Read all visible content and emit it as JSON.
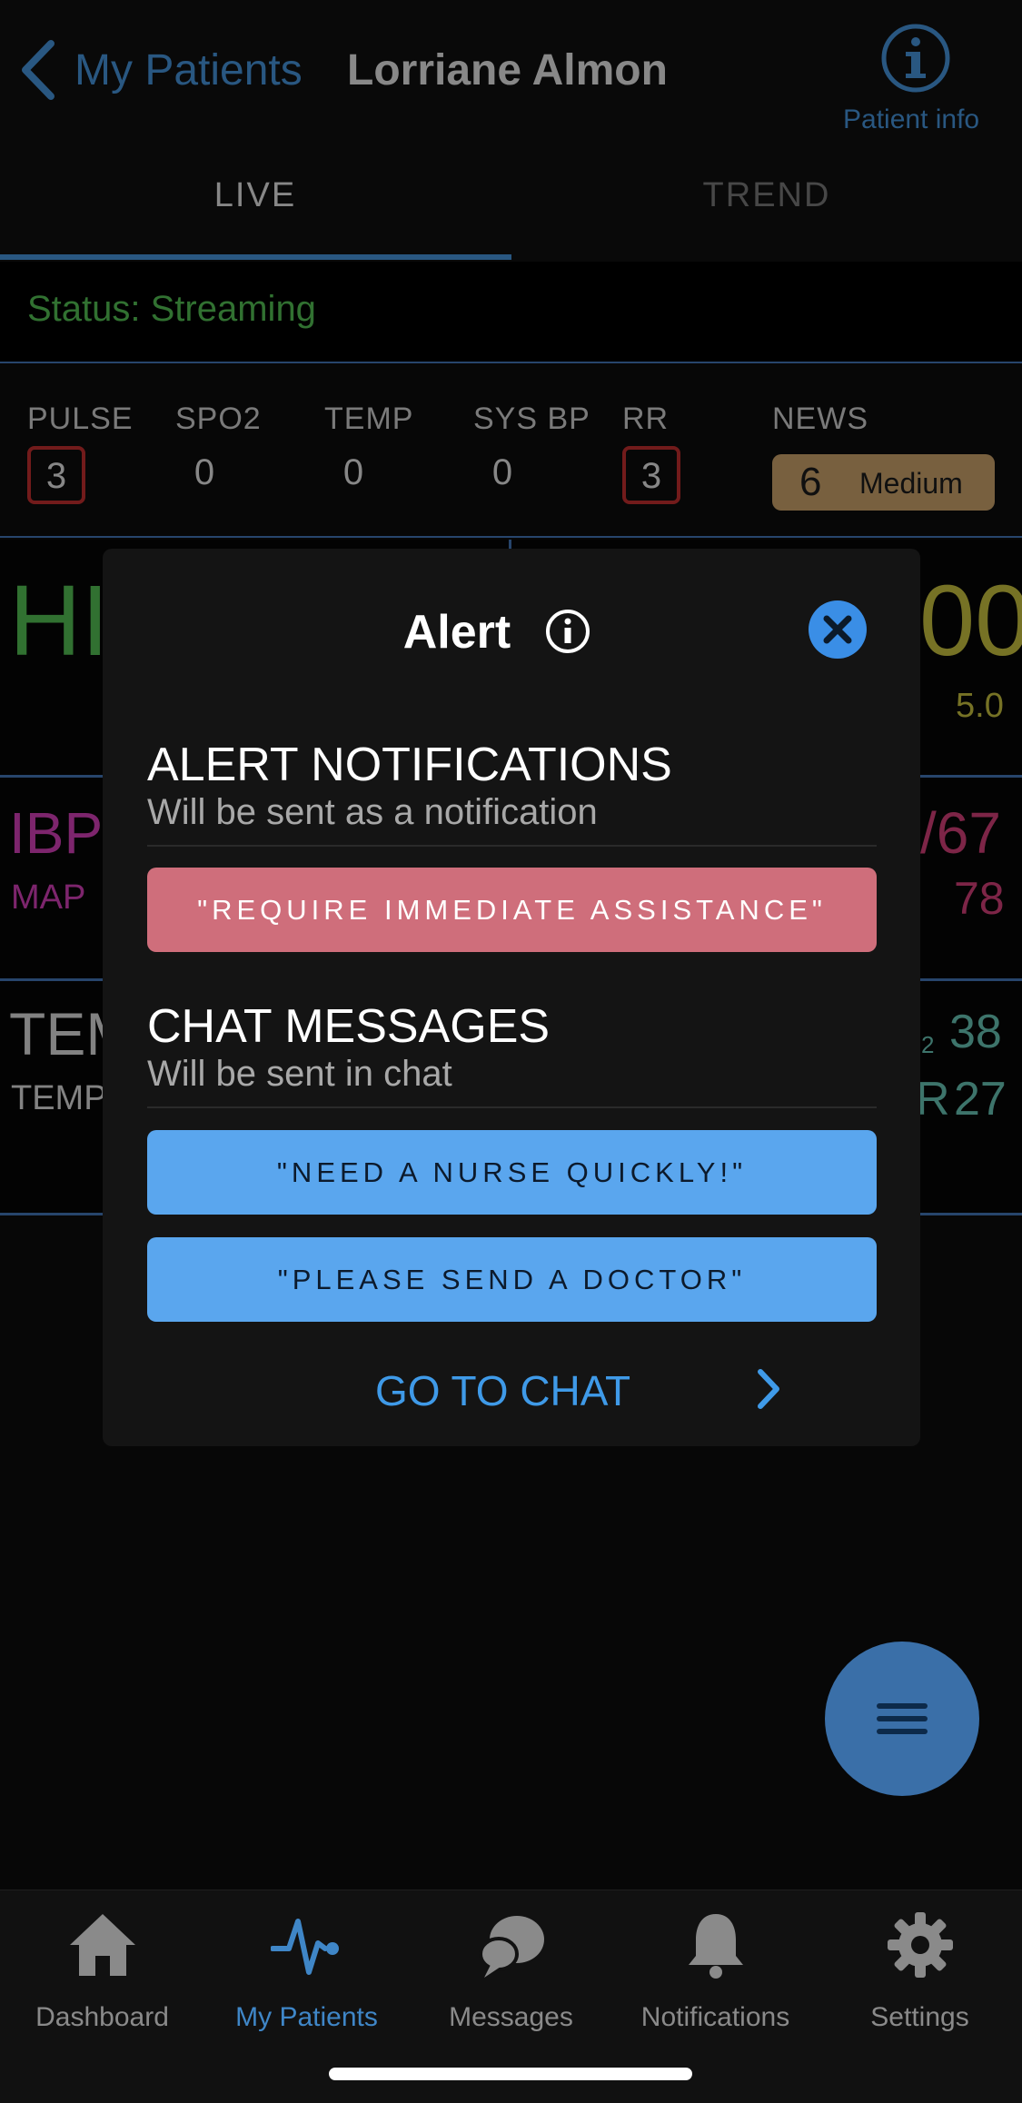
{
  "header": {
    "back_label": "My Patients",
    "patient_name": "Lorriane Almon",
    "info_label": "Patient info"
  },
  "tabs": [
    {
      "label": "LIVE",
      "active": true
    },
    {
      "label": "TREND",
      "active": false
    }
  ],
  "status": {
    "text": "Status: Streaming",
    "color": "#4cae4c"
  },
  "scores": [
    {
      "label": "PULSE",
      "value": "3",
      "flag": true
    },
    {
      "label": "SPO2",
      "value": "0",
      "flag": false
    },
    {
      "label": "TEMP",
      "value": "0",
      "flag": false
    },
    {
      "label": "SYS BP",
      "value": "0",
      "flag": false
    },
    {
      "label": "RR",
      "value": "3",
      "flag": true
    }
  ],
  "news": {
    "label": "NEWS",
    "score": "6",
    "level": "Medium",
    "color": "#b89462"
  },
  "background_vitals": {
    "hr_label": "HI",
    "hr_value": "00",
    "hr_sub": "5.0",
    "ibp_label": "IBP",
    "ibp_value": "/67",
    "map_label": "MAP",
    "map_value": "78",
    "temp_label": "TEM",
    "temp_sub_label": "TEMP",
    "spo2_sub": "2",
    "spo2_value": "38",
    "rr_label": "R",
    "rr_value": "27"
  },
  "modal": {
    "title": "Alert",
    "alert_section": {
      "title": "ALERT NOTIFICATIONS",
      "subtitle": "Will be sent as a notification",
      "button": "\"REQUIRE IMMEDIATE ASSISTANCE\""
    },
    "chat_section": {
      "title": "CHAT MESSAGES",
      "subtitle": "Will be sent in chat",
      "buttons": [
        "\"NEED A NURSE QUICKLY!\"",
        "\"PLEASE SEND A DOCTOR\""
      ]
    },
    "go_to_chat": "GO TO CHAT"
  },
  "bottom_nav": [
    {
      "label": "Dashboard",
      "icon": "home-icon",
      "active": false
    },
    {
      "label": "My Patients",
      "icon": "heartbeat-icon",
      "active": true
    },
    {
      "label": "Messages",
      "icon": "chat-bubbles-icon",
      "active": false
    },
    {
      "label": "Notifications",
      "icon": "bell-icon",
      "active": false
    },
    {
      "label": "Settings",
      "icon": "gear-icon",
      "active": false
    }
  ],
  "colors": {
    "accent": "#3f86c7",
    "alert_red": "#cf6e7b",
    "chat_blue": "#5aa6ee",
    "hr_green": "#4cae4c",
    "ibp_magenta": "#c03aa8",
    "hr_yellow": "#b6b03a"
  }
}
